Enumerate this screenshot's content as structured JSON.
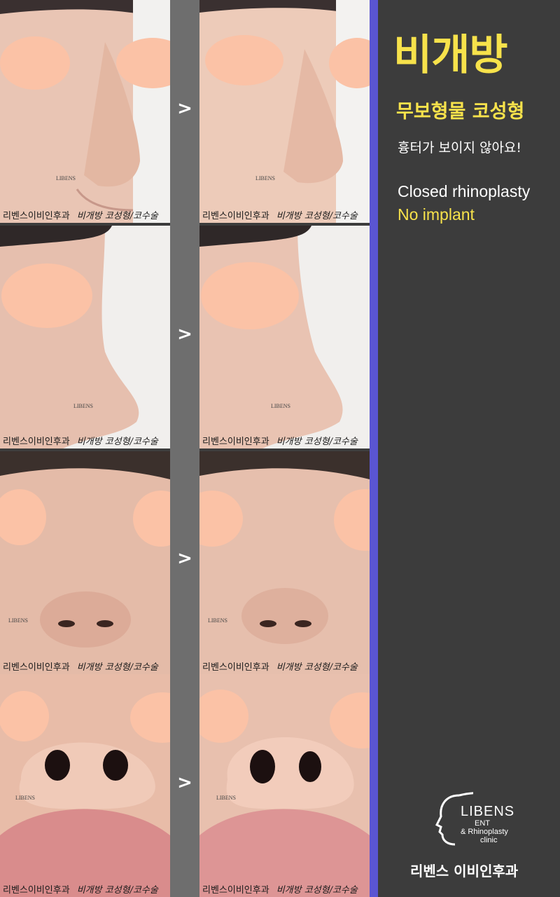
{
  "title": "비개방",
  "subtitle": "무보형물 코성형",
  "tagline": "흉터가 보이지 않아요!",
  "english_line1": "Closed rhinoplasty",
  "english_line2": "No implant",
  "compare_symbol": ">",
  "watermark": {
    "clinic": "리벤스이비인후과",
    "handwritten": "비개방 코성형/코수술"
  },
  "photo_logo": "LIBENS",
  "brand": {
    "name": "LIBENS",
    "line2": "ENT",
    "line3": "& Rhinoplasty",
    "line4": "clinic",
    "korean": "리벤스 이비인후과"
  },
  "photo_views": [
    "side-45",
    "profile",
    "front",
    "base"
  ],
  "colors": {
    "background": "#3c3c3c",
    "separator": "#6e6e6e",
    "accent_bar": "#5a55d2",
    "highlight_yellow": "#f7e24b",
    "face_mask": "#fbc2a6"
  }
}
